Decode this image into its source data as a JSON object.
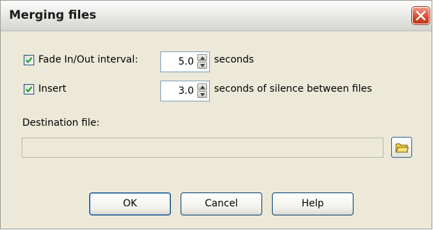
{
  "window": {
    "title": "Merging files",
    "close_icon": "close-x-icon"
  },
  "fade": {
    "checked": true,
    "label": "Fade In/Out interval:",
    "value": "5.0",
    "unit": "seconds"
  },
  "insert": {
    "checked": true,
    "label": "Insert",
    "value": "3.0",
    "unit": "seconds of silence between files"
  },
  "destination": {
    "label": "Destination file:",
    "value": "",
    "browse_icon": "folder-icon"
  },
  "buttons": {
    "ok": "OK",
    "cancel": "Cancel",
    "help": "Help"
  },
  "colors": {
    "close_red": "#d8462c",
    "check_green": "#21a121",
    "dialog_bg": "#ece9d8",
    "button_border": "#003c74"
  }
}
